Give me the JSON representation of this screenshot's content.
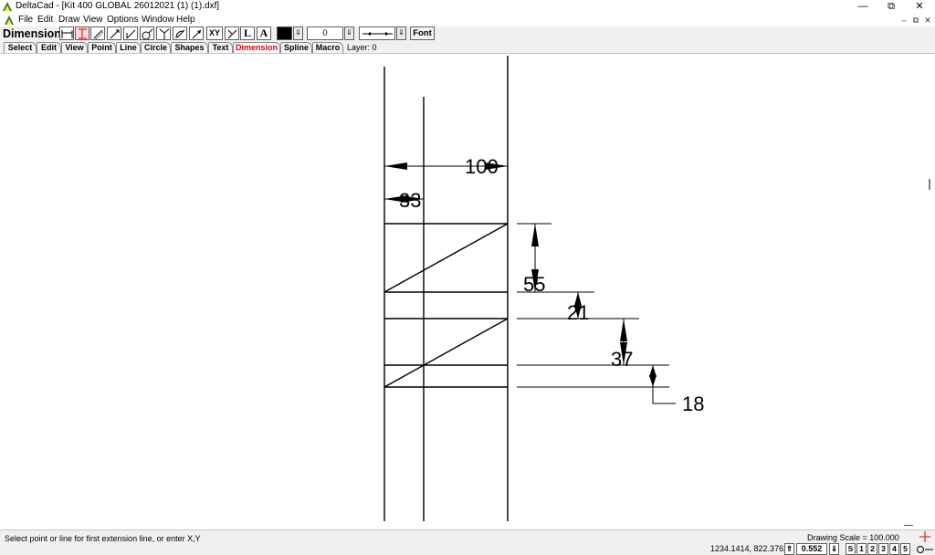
{
  "window": {
    "title": "DeltaCad - [Kit 400 GLOBAL  26012021 (1) (1).dxf]",
    "minimize": "—",
    "restore": "⧉",
    "close": "✕",
    "accent_color": "#2e7d32"
  },
  "menu": {
    "items": [
      "File",
      "Edit",
      "Draw",
      "View",
      "Options",
      "Window",
      "Help"
    ],
    "mdi_minimize": "–",
    "mdi_restore": "⧉",
    "mdi_close": "✕"
  },
  "toolbar": {
    "mode_label": "Dimension",
    "tools": [
      {
        "name": "horizontal-dimension-icon",
        "label": ""
      },
      {
        "name": "vertical-dimension-icon",
        "label": ""
      },
      {
        "name": "aligned-dimension-icon",
        "label": ""
      },
      {
        "name": "parallel-dimension-icon",
        "label": ""
      },
      {
        "name": "baseline-dimension-icon",
        "label": ""
      },
      {
        "name": "diameter-dimension-icon",
        "label": ""
      },
      {
        "name": "angle-dimension-icon",
        "label": ""
      },
      {
        "name": "radius-dimension-icon",
        "label": ""
      },
      {
        "name": "leader-dimension-icon",
        "label": ""
      },
      {
        "name": "xy-coordinate-icon",
        "label": "XY"
      },
      {
        "name": "arrow-style-icon",
        "label": ""
      },
      {
        "name": "line-style-icon",
        "label": "L"
      },
      {
        "name": "text-style-icon",
        "label": "A"
      }
    ],
    "color_value": "#000000",
    "number_value": "0",
    "spin_glyph": "⇓",
    "font_label": "Font"
  },
  "tabs": {
    "items": [
      "Select",
      "Edit",
      "View",
      "Point",
      "Line",
      "Circle",
      "Shapes",
      "Text",
      "Dimension",
      "Spline",
      "Macro"
    ],
    "active": "Dimension",
    "active_color": "#e00000",
    "layer_label": "Layer: 0"
  },
  "drawing": {
    "dimensions": [
      "100",
      "33",
      "55",
      "21",
      "37",
      "18"
    ]
  },
  "status": {
    "prompt": "Select point or line for first extension line, or enter X,Y",
    "drawing_scale": "Drawing Scale = 100.000",
    "coordinates": "1234.1414, 822.3762",
    "zoom_up": "⇑",
    "zoom_value": "0.552",
    "zoom_down": "⇓",
    "view_buttons": [
      "S",
      "1",
      "2",
      "3",
      "4",
      "5"
    ]
  }
}
